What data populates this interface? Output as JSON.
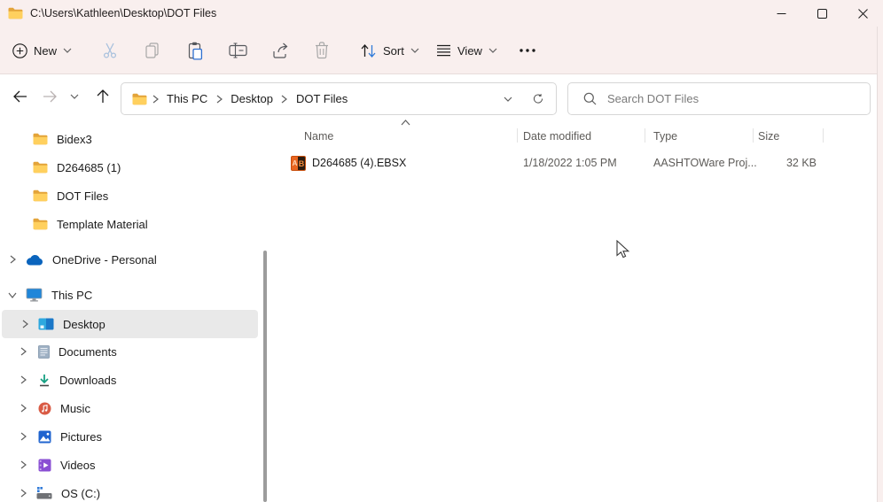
{
  "titlebar": {
    "path": "C:\\Users\\Kathleen\\Desktop\\DOT Files"
  },
  "toolbar": {
    "new_label": "New",
    "sort_label": "Sort",
    "view_label": "View"
  },
  "navigation": {
    "breadcrumbs": [
      "This PC",
      "Desktop",
      "DOT Files"
    ],
    "search_placeholder": "Search DOT Files"
  },
  "sidebar": {
    "pinned_folders": [
      "Bidex3",
      "D264685 (1)",
      "DOT Files",
      "Template Material"
    ],
    "onedrive_label": "OneDrive - Personal",
    "this_pc_label": "This PC",
    "this_pc_children": [
      "Desktop",
      "Documents",
      "Downloads",
      "Music",
      "Pictures",
      "Videos",
      "OS (C:)"
    ],
    "selected_item": "Desktop"
  },
  "file_list": {
    "columns": [
      "Name",
      "Date modified",
      "Type",
      "Size"
    ],
    "sort": {
      "column": "Name",
      "direction": "ascending"
    },
    "files": [
      {
        "name": "D264685 (4).EBSX",
        "date_modified": "1/18/2022 1:05 PM",
        "type": "AASHTOWare Proj...",
        "size": "32 KB",
        "icon_left": "A",
        "icon_right": "B"
      }
    ]
  },
  "colors": {
    "chrome_bg": "#f9efee",
    "window_bg": "#ffffff",
    "border": "#d6d6d6",
    "text_primary": "#1b1b1b",
    "text_secondary": "#5d5b58",
    "selected_bg": "#e9e9e9",
    "folder_yellow": "#ffd05e",
    "file_icon_orange": "#e8651f",
    "accent_blue": "#2f7ad8"
  }
}
